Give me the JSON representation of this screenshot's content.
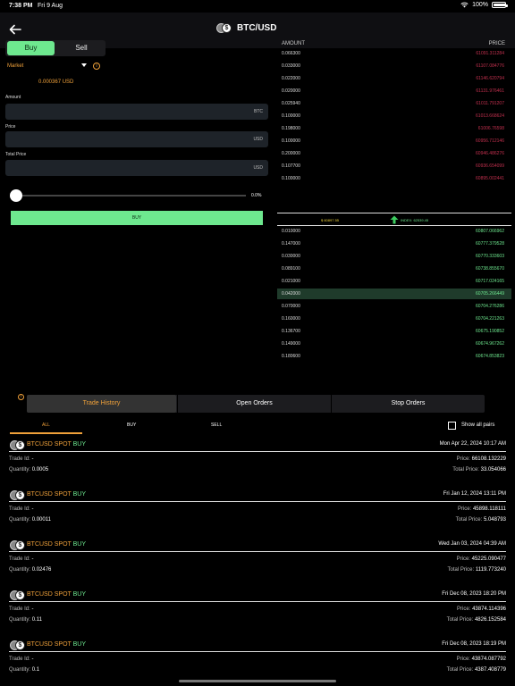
{
  "status_bar": {
    "time": "7:38 PM",
    "date": "Fri 9 Aug",
    "battery": "100%",
    "battery_level": 1.0
  },
  "header": {
    "title": "BTC/USD"
  },
  "trade_form": {
    "side_buy": "Buy",
    "side_sell": "Sell",
    "order_type": "Market",
    "balance": "0.000367 USD",
    "amount_label": "Amount",
    "amount_unit": "BTC",
    "price_label": "Price",
    "price_unit": "USD",
    "total_label": "Total Price",
    "total_unit": "USD",
    "slider_value": "0.0%",
    "slider_fraction": 0.0,
    "buy_button": "BUY"
  },
  "order_book": {
    "amount_header": "AMOUNT",
    "price_header": "PRICE",
    "asks": [
      {
        "amount": "0.066300",
        "price": "61091.311284"
      },
      {
        "amount": "0.033000",
        "price": "61107.084776"
      },
      {
        "amount": "0.022000",
        "price": "61146.620794"
      },
      {
        "amount": "0.020000",
        "price": "61131.976461"
      },
      {
        "amount": "0.025940",
        "price": "61011.791207"
      },
      {
        "amount": "0.100000",
        "price": "61013.668624"
      },
      {
        "amount": "0.198000",
        "price": "61006.76598"
      },
      {
        "amount": "0.100000",
        "price": "60956.712146"
      },
      {
        "amount": "0.200000",
        "price": "60946.486276"
      },
      {
        "amount": "0.107700",
        "price": "60936.654099"
      },
      {
        "amount": "0.100000",
        "price": "60895.002441"
      }
    ],
    "last_price": "$ 60897.55",
    "index_price": "INDEX: 62539.45",
    "bids": [
      {
        "amount": "0.010000",
        "price": "60807.066962"
      },
      {
        "amount": "0.147000",
        "price": "60777.379528"
      },
      {
        "amount": "0.030000",
        "price": "60770.333603"
      },
      {
        "amount": "0.089100",
        "price": "60738.855670"
      },
      {
        "amount": "0.021000",
        "price": "60717.024165"
      },
      {
        "amount": "0.042000",
        "price": "60705.266449"
      },
      {
        "amount": "0.070000",
        "price": "60704.276286"
      },
      {
        "amount": "0.160000",
        "price": "60704.221263"
      },
      {
        "amount": "0.136700",
        "price": "60675.190852"
      },
      {
        "amount": "0.149000",
        "price": "60674.967262"
      },
      {
        "amount": "0.180600",
        "price": "60674.853823"
      }
    ]
  },
  "tabs": {
    "trade_history": "Trade History",
    "open_orders": "Open Orders",
    "stop_orders": "Stop Orders"
  },
  "filters": {
    "all": "ALL",
    "buy": "BUY",
    "sell": "SELL",
    "show_all_pairs": "Show all pairs"
  },
  "trades": [
    {
      "pair": "BTCUSD",
      "market": "SPOT",
      "side": "BUY",
      "date": "Mon Apr 22, 2024 10:17 AM",
      "trade_id_label": "Trade Id:",
      "trade_id": "-",
      "quantity_label": "Quantity:",
      "quantity": "0.0005",
      "price_label": "Price:",
      "price": "66108.132229",
      "total_label": "Total Price:",
      "total": "33.054066"
    },
    {
      "pair": "BTCUSD",
      "market": "SPOT",
      "side": "BUY",
      "date": "Fri Jan 12, 2024 13:11 PM",
      "trade_id_label": "Trade Id:",
      "trade_id": "-",
      "quantity_label": "Quantity:",
      "quantity": "0.00011",
      "price_label": "Price:",
      "price": "45898.118111",
      "total_label": "Total Price:",
      "total": "5.048793"
    },
    {
      "pair": "BTCUSD",
      "market": "SPOT",
      "side": "BUY",
      "date": "Wed Jan 03, 2024 04:39 AM",
      "trade_id_label": "Trade Id:",
      "trade_id": "-",
      "quantity_label": "Quantity:",
      "quantity": "0.02476",
      "price_label": "Price:",
      "price": "45225.090477",
      "total_label": "Total Price:",
      "total": "1119.773240"
    },
    {
      "pair": "BTCUSD",
      "market": "SPOT",
      "side": "BUY",
      "date": "Fri Dec 08, 2023 18:20 PM",
      "trade_id_label": "Trade Id:",
      "trade_id": "-",
      "quantity_label": "Quantity:",
      "quantity": "0.11",
      "price_label": "Price:",
      "price": "43874.114396",
      "total_label": "Total Price:",
      "total": "4826.152584"
    },
    {
      "pair": "BTCUSD",
      "market": "SPOT",
      "side": "BUY",
      "date": "Fri Dec 08, 2023 18:19 PM",
      "trade_id_label": "Trade Id:",
      "trade_id": "-",
      "quantity_label": "Quantity:",
      "quantity": "0.1",
      "price_label": "Price:",
      "price": "43874.087792",
      "total_label": "Total Price:",
      "total": "4387.408779"
    }
  ]
}
